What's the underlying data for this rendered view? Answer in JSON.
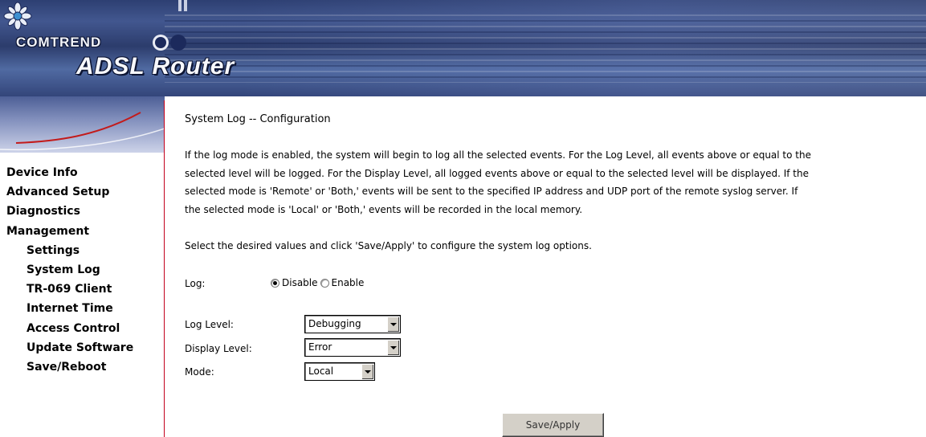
{
  "header": {
    "brand": "COMTREND",
    "product": "ADSL Router"
  },
  "sidebar": {
    "items": [
      {
        "label": "Device Info"
      },
      {
        "label": "Advanced Setup"
      },
      {
        "label": "Diagnostics"
      },
      {
        "label": "Management"
      },
      {
        "label": "Settings"
      },
      {
        "label": "System Log"
      },
      {
        "label": "TR-069 Client"
      },
      {
        "label": "Internet Time"
      },
      {
        "label": "Access Control"
      },
      {
        "label": "Update Software"
      },
      {
        "label": "Save/Reboot"
      }
    ]
  },
  "main": {
    "title": "System Log -- Configuration",
    "description_lines": [
      "If the log mode is enabled, the system will begin to log all the selected events. For the Log Level, all events above or equal to the",
      "selected level will be logged. For the Display Level, all logged events above or equal to the selected level will be displayed. If the",
      "selected mode is 'Remote' or 'Both,' events will be sent to the specified IP address and UDP port of the remote syslog server. If",
      "the selected mode is 'Local' or 'Both,' events will be recorded in the local memory."
    ],
    "instruction": "Select the desired values and click 'Save/Apply' to configure the system log options.",
    "log": {
      "label": "Log:",
      "options": [
        {
          "label": "Disable",
          "checked": true
        },
        {
          "label": "Enable",
          "checked": false
        }
      ]
    },
    "log_level": {
      "label": "Log Level:",
      "value": "Debugging"
    },
    "display_level": {
      "label": "Display Level:",
      "value": "Error"
    },
    "mode": {
      "label": "Mode:",
      "value": "Local"
    },
    "save_label": "Save/Apply"
  }
}
